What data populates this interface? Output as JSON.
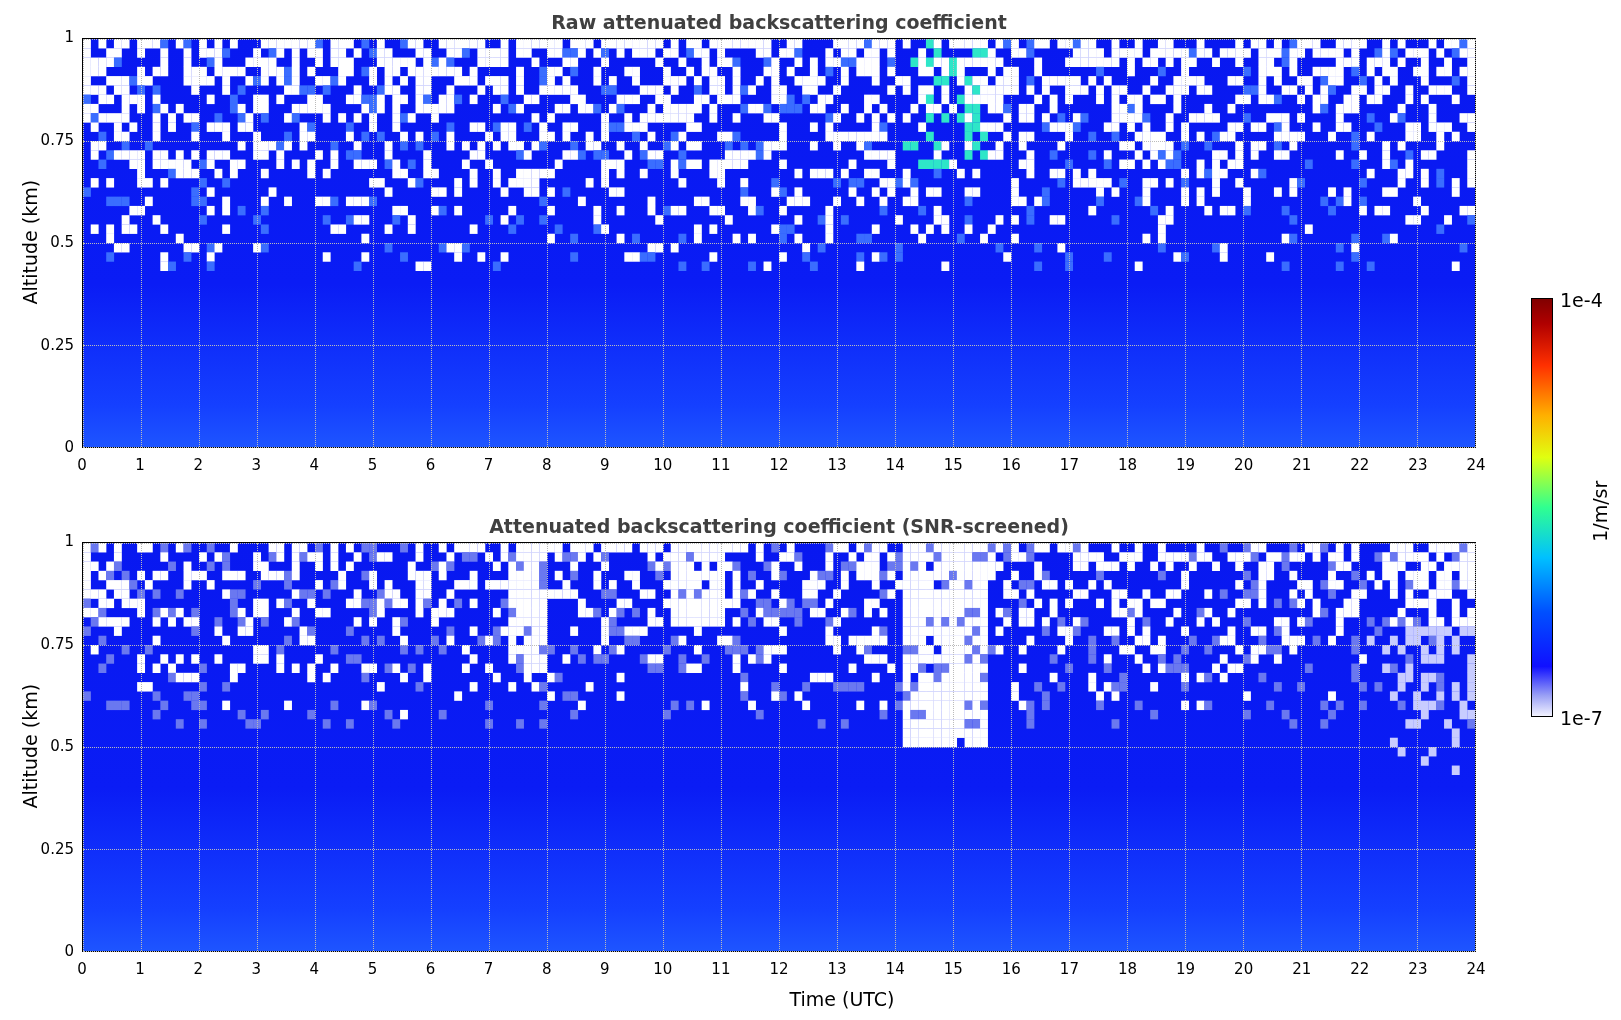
{
  "plots": [
    {
      "title": "Raw attenuated backscattering coefficient",
      "ylabel": "Altitude (km)",
      "kind": "raw",
      "yticks": [
        "1",
        "0.75",
        "0.5",
        "0.25",
        "0"
      ],
      "xticks": [
        "0",
        "1",
        "2",
        "3",
        "4",
        "5",
        "6",
        "7",
        "8",
        "9",
        "10",
        "11",
        "12",
        "13",
        "14",
        "15",
        "16",
        "17",
        "18",
        "19",
        "20",
        "21",
        "22",
        "23",
        "24"
      ]
    },
    {
      "title": "Attenuated backscattering coefficient (SNR-screened)",
      "ylabel": "Altitude (km)",
      "kind": "screened",
      "yticks": [
        "1",
        "0.75",
        "0.5",
        "0.25",
        "0"
      ],
      "xticks": [
        "0",
        "1",
        "2",
        "3",
        "4",
        "5",
        "6",
        "7",
        "8",
        "9",
        "10",
        "11",
        "12",
        "13",
        "14",
        "15",
        "16",
        "17",
        "18",
        "19",
        "20",
        "21",
        "22",
        "23",
        "24"
      ]
    }
  ],
  "xlabel": "Time (UTC)",
  "colorbar": {
    "label": "1/m/sr",
    "max": "1e-4",
    "min": "1e-7"
  }
}
